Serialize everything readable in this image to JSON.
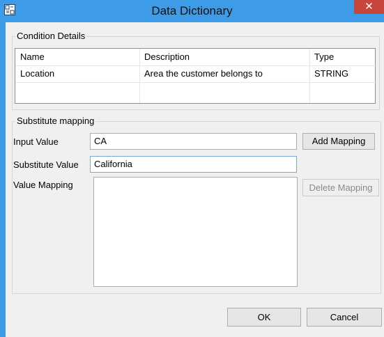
{
  "window": {
    "title": "Data Dictionary",
    "close_glyph": "✕",
    "app_icon": "data-dictionary-icon"
  },
  "condition_details": {
    "legend": "Condition Details",
    "columns": [
      "Name",
      "Description",
      "Type"
    ],
    "rows": [
      {
        "name": "Location",
        "description": "Area the customer belongs to",
        "type": "STRING"
      }
    ]
  },
  "substitute_mapping": {
    "legend": "Substitute mapping",
    "input_value_label": "Input Value",
    "input_value": "CA",
    "substitute_value_label": "Substitute Value",
    "substitute_value": "California",
    "value_mapping_label": "Value Mapping",
    "value_mapping_items": [],
    "add_mapping_label": "Add Mapping",
    "delete_mapping_label": "Delete Mapping"
  },
  "footer": {
    "ok_label": "OK",
    "cancel_label": "Cancel"
  }
}
